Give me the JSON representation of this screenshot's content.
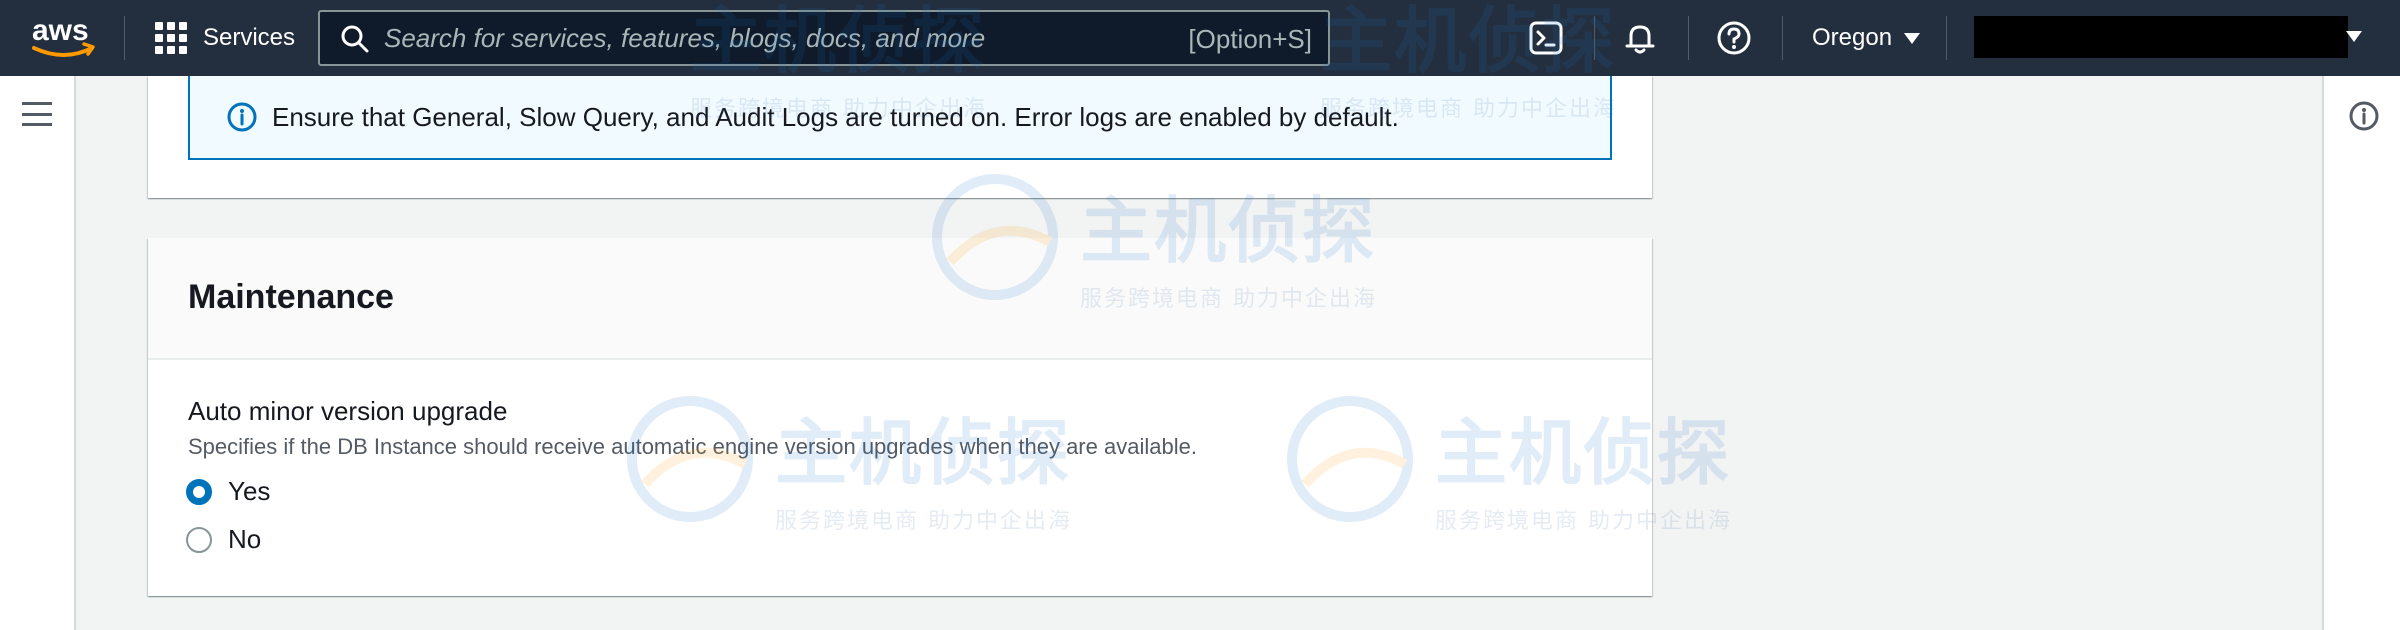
{
  "nav": {
    "services_label": "Services",
    "search_placeholder": "Search for services, features, blogs, docs, and more",
    "search_shortcut": "[Option+S]",
    "region": "Oregon"
  },
  "alert": {
    "text": "Ensure that General, Slow Query, and Audit Logs are turned on. Error logs are enabled by default."
  },
  "maintenance": {
    "title": "Maintenance",
    "field_label": "Auto minor version upgrade",
    "field_description": "Specifies if the DB Instance should receive automatic engine version upgrades when they are available.",
    "options": [
      {
        "label": "Yes",
        "selected": true
      },
      {
        "label": "No",
        "selected": false
      }
    ]
  },
  "watermark": {
    "title": "主机侦探",
    "subtitle": "服务跨境电商 助力中企出海"
  },
  "colors": {
    "nav_bg": "#232f3e",
    "accent": "#0073bb",
    "alert_bg": "#f1faff",
    "aws_orange": "#ff9900"
  }
}
